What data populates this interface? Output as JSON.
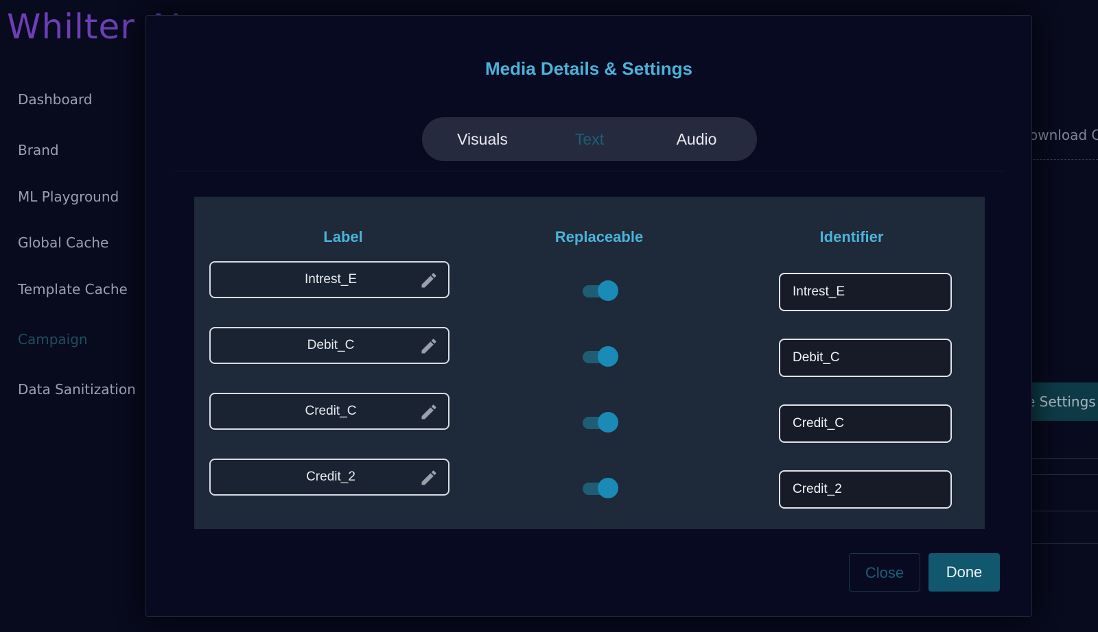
{
  "app": {
    "logo": "Whilter AI"
  },
  "sidebar": {
    "items": [
      {
        "label": "Dashboard"
      },
      {
        "label": "Brand"
      },
      {
        "label": "ML Playground"
      },
      {
        "label": "Global Cache"
      },
      {
        "label": "Template Cache"
      },
      {
        "label": "Campaign",
        "active": true
      },
      {
        "label": "Data Sanitization"
      }
    ]
  },
  "background": {
    "download_text": "ownload C",
    "settings_text": "e Settings"
  },
  "modal": {
    "title": "Media Details & Settings",
    "tabs": [
      {
        "label": "Visuals"
      },
      {
        "label": "Text",
        "active": true
      },
      {
        "label": "Audio"
      }
    ],
    "columns": {
      "label": "Label",
      "replaceable": "Replaceable",
      "identifier": "Identifier"
    },
    "rows": [
      {
        "label": "Intrest_E",
        "replaceable": true,
        "identifier": "Intrest_E"
      },
      {
        "label": "Debit_C",
        "replaceable": true,
        "identifier": "Debit_C"
      },
      {
        "label": "Credit_C",
        "replaceable": true,
        "identifier": "Credit_C"
      },
      {
        "label": "Credit_2",
        "replaceable": true,
        "identifier": "Credit_2"
      }
    ],
    "buttons": {
      "close": "Close",
      "done": "Done"
    }
  },
  "colors": {
    "accent": "#4ab3d8",
    "toggle_on": "#1a8ab6",
    "done_button": "#11576e"
  }
}
